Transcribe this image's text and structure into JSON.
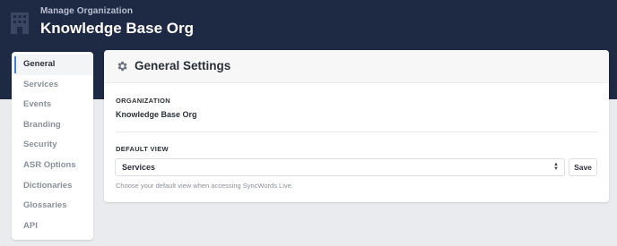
{
  "header": {
    "subtitle": "Manage Organization",
    "title": "Knowledge Base Org"
  },
  "sidebar": {
    "items": [
      {
        "label": "General",
        "active": true
      },
      {
        "label": "Services"
      },
      {
        "label": "Events"
      },
      {
        "label": "Branding"
      },
      {
        "label": "Security"
      },
      {
        "label": "ASR Options"
      },
      {
        "label": "Dictionaries"
      },
      {
        "label": "Glossaries"
      },
      {
        "label": "API"
      }
    ]
  },
  "settings": {
    "title": "General Settings",
    "organization_label": "ORGANIZATION",
    "organization_value": "Knowledge Base Org",
    "default_view_label": "DEFAULT VIEW",
    "default_view_value": "Services",
    "save_label": "Save",
    "help_text": "Choose your default view when accessing SyncWords Live."
  },
  "icons": {
    "header": "building-icon",
    "settings": "gear-icon",
    "select": "sort-arrows-icon"
  },
  "colors": {
    "header_bg": "#1e2a44",
    "accent": "#4a7bd8",
    "page_bg": "#e9ebee"
  }
}
